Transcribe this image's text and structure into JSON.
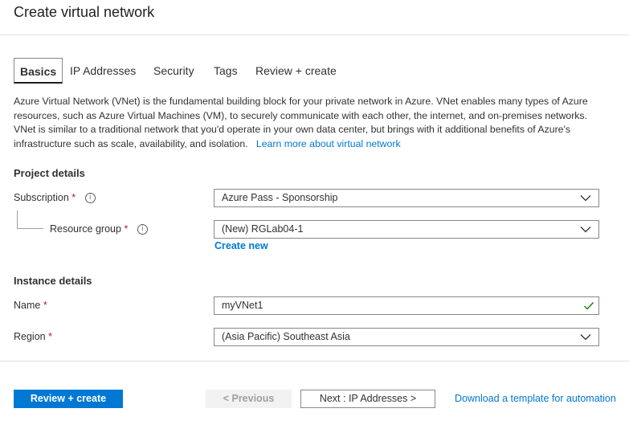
{
  "page": {
    "title": "Create virtual network"
  },
  "tabs": [
    {
      "label": "Basics",
      "active": true
    },
    {
      "label": "IP Addresses"
    },
    {
      "label": "Security"
    },
    {
      "label": "Tags"
    },
    {
      "label": "Review + create"
    }
  ],
  "description": {
    "text": "Azure Virtual Network (VNet) is the fundamental building block for your private network in Azure. VNet enables many types of Azure resources, such as Azure Virtual Machines (VM), to securely communicate with each other, the internet, and on-premises networks. VNet is similar to a traditional network that you'd operate in your own data center, but brings with it additional benefits of Azure's infrastructure such as scale, availability, and isolation.",
    "link": "Learn more about virtual network"
  },
  "project_details": {
    "heading": "Project details",
    "subscription": {
      "label": "Subscription",
      "value": "Azure Pass - Sponsorship"
    },
    "resource_group": {
      "label": "Resource group",
      "value": "(New) RGLab04-1",
      "create_new": "Create new"
    }
  },
  "instance_details": {
    "heading": "Instance details",
    "name": {
      "label": "Name",
      "value": "myVNet1"
    },
    "region": {
      "label": "Region",
      "value": "(Asia Pacific) Southeast Asia"
    }
  },
  "required_marker": "*",
  "info_glyph": "i",
  "footer": {
    "review_create": "Review + create",
    "previous": "< Previous",
    "next": "Next : IP Addresses >",
    "download_template": "Download a template for automation"
  },
  "colors": {
    "accent": "#0078d4",
    "required": "#a4262c",
    "valid": "#107c10"
  }
}
